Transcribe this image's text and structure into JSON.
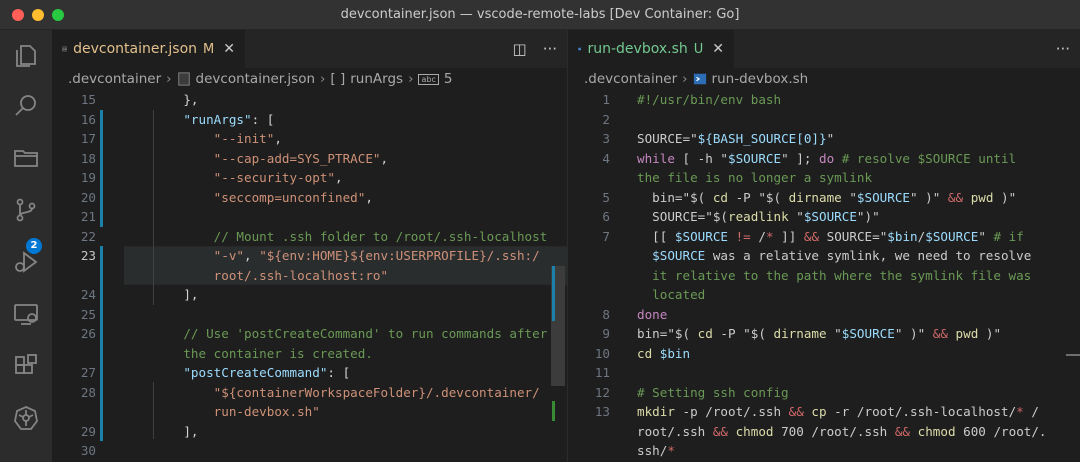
{
  "window": {
    "title": "devcontainer.json — vscode-remote-labs [Dev Container: Go]"
  },
  "activity_bar": {
    "icons": [
      "explorer-icon",
      "search-icon",
      "folder-icon",
      "source-control-icon",
      "run-debug-icon",
      "remote-explorer-icon",
      "extensions-icon",
      "kubernetes-icon"
    ],
    "source_control_badge": "2"
  },
  "left_editor": {
    "tab": {
      "label": "devcontainer.json",
      "status": "M",
      "close": "✕"
    },
    "actions": {
      "split": "◫",
      "more": "···"
    },
    "breadcrumb": {
      "folder": ".devcontainer",
      "file": "devcontainer.json",
      "symbol_icon": "[ ]",
      "symbol": "runArgs",
      "element_icon": "abc",
      "element": "5"
    },
    "line_numbers": [
      "15",
      "16",
      "17",
      "18",
      "19",
      "20",
      "21",
      "22",
      "23",
      "",
      "24",
      "25",
      "26",
      "",
      "27",
      "28",
      "",
      "29",
      "30"
    ],
    "active_line": "23",
    "lines": [
      "    },",
      "    \"runArgs\": [",
      "        \"--init\",",
      "        \"--cap-add=SYS_PTRACE\",",
      "        \"--security-opt\",",
      "        \"seccomp=unconfined\",",
      "",
      "        // Mount .ssh folder to /root/.ssh-localhost",
      "        \"-v\", \"${env:HOME}${env:USERPROFILE}/.ssh:/",
      "        root/.ssh-localhost:ro\"",
      "    ],",
      "",
      "    // Use 'postCreateCommand' to run commands after",
      "    the container is created.",
      "    \"postCreateCommand\": [",
      "        \"${containerWorkspaceFolder}/.devcontainer/",
      "        run-devbox.sh\"",
      "    ],",
      ""
    ]
  },
  "right_editor": {
    "tab": {
      "label": "run-devbox.sh",
      "status": "U",
      "close": "✕"
    },
    "actions": {
      "more": "···"
    },
    "breadcrumb": {
      "folder": ".devcontainer",
      "file": "run-devbox.sh"
    },
    "line_numbers": [
      "1",
      "2",
      "3",
      "4",
      "",
      "5",
      "6",
      "7",
      "",
      "",
      "",
      "8",
      "9",
      "10",
      "11",
      "12",
      "13",
      "",
      ""
    ],
    "lines": [
      "#!/usr/bin/env bash",
      "",
      "SOURCE=\"${BASH_SOURCE[0]}\"",
      "while [ -h \"$SOURCE\" ]; do # resolve $SOURCE until",
      "the file is no longer a symlink",
      "  bin=\"$( cd -P \"$( dirname \"$SOURCE\" )\" && pwd )\"",
      "  SOURCE=\"$(readlink \"$SOURCE\")\"",
      "  [[ $SOURCE != /* ]] && SOURCE=\"$bin/$SOURCE\" # if",
      "  $SOURCE was a relative symlink, we need to resolve",
      "  it relative to the path where the symlink file was",
      "  located",
      "done",
      "bin=\"$( cd -P \"$( dirname \"$SOURCE\" )\" && pwd )\"",
      "cd $bin",
      "",
      "# Setting ssh config",
      "mkdir -p /root/.ssh && cp -r /root/.ssh-localhost/* /",
      "root/.ssh && chmod 700 /root/.ssh && chmod 600 /root/.",
      "ssh/*"
    ]
  },
  "colors": {
    "titlebar": "#323233",
    "activitybar": "#2c2c2c",
    "editor_bg": "#1e1e1e",
    "tab_inactive": "#252526",
    "modified_status": "#e2c08d",
    "untracked_status": "#73c991",
    "accent_blue": "#0078d4",
    "gutter_added": "#1b81a8"
  }
}
